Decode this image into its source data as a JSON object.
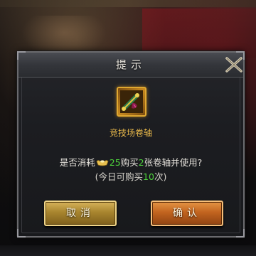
{
  "dialog": {
    "title": "提示",
    "item": {
      "name": "竞技场卷轴",
      "icon": "scroll-icon"
    },
    "message": {
      "prefix": "是否消耗",
      "currency_icon": "gold-ingot-icon",
      "cost": "25",
      "middle": "购买",
      "quantity": "2",
      "suffix": "张卷轴并使用?"
    },
    "sub_message": {
      "prefix": "(今日可购买",
      "remaining": "10",
      "suffix": "次)"
    },
    "buttons": {
      "cancel": "取消",
      "confirm": "确认"
    }
  },
  "colors": {
    "highlight_green": "#4dd13c",
    "item_name_gold": "#e8b84a",
    "cancel_button": "#c9a448",
    "confirm_button": "#d07a32"
  }
}
